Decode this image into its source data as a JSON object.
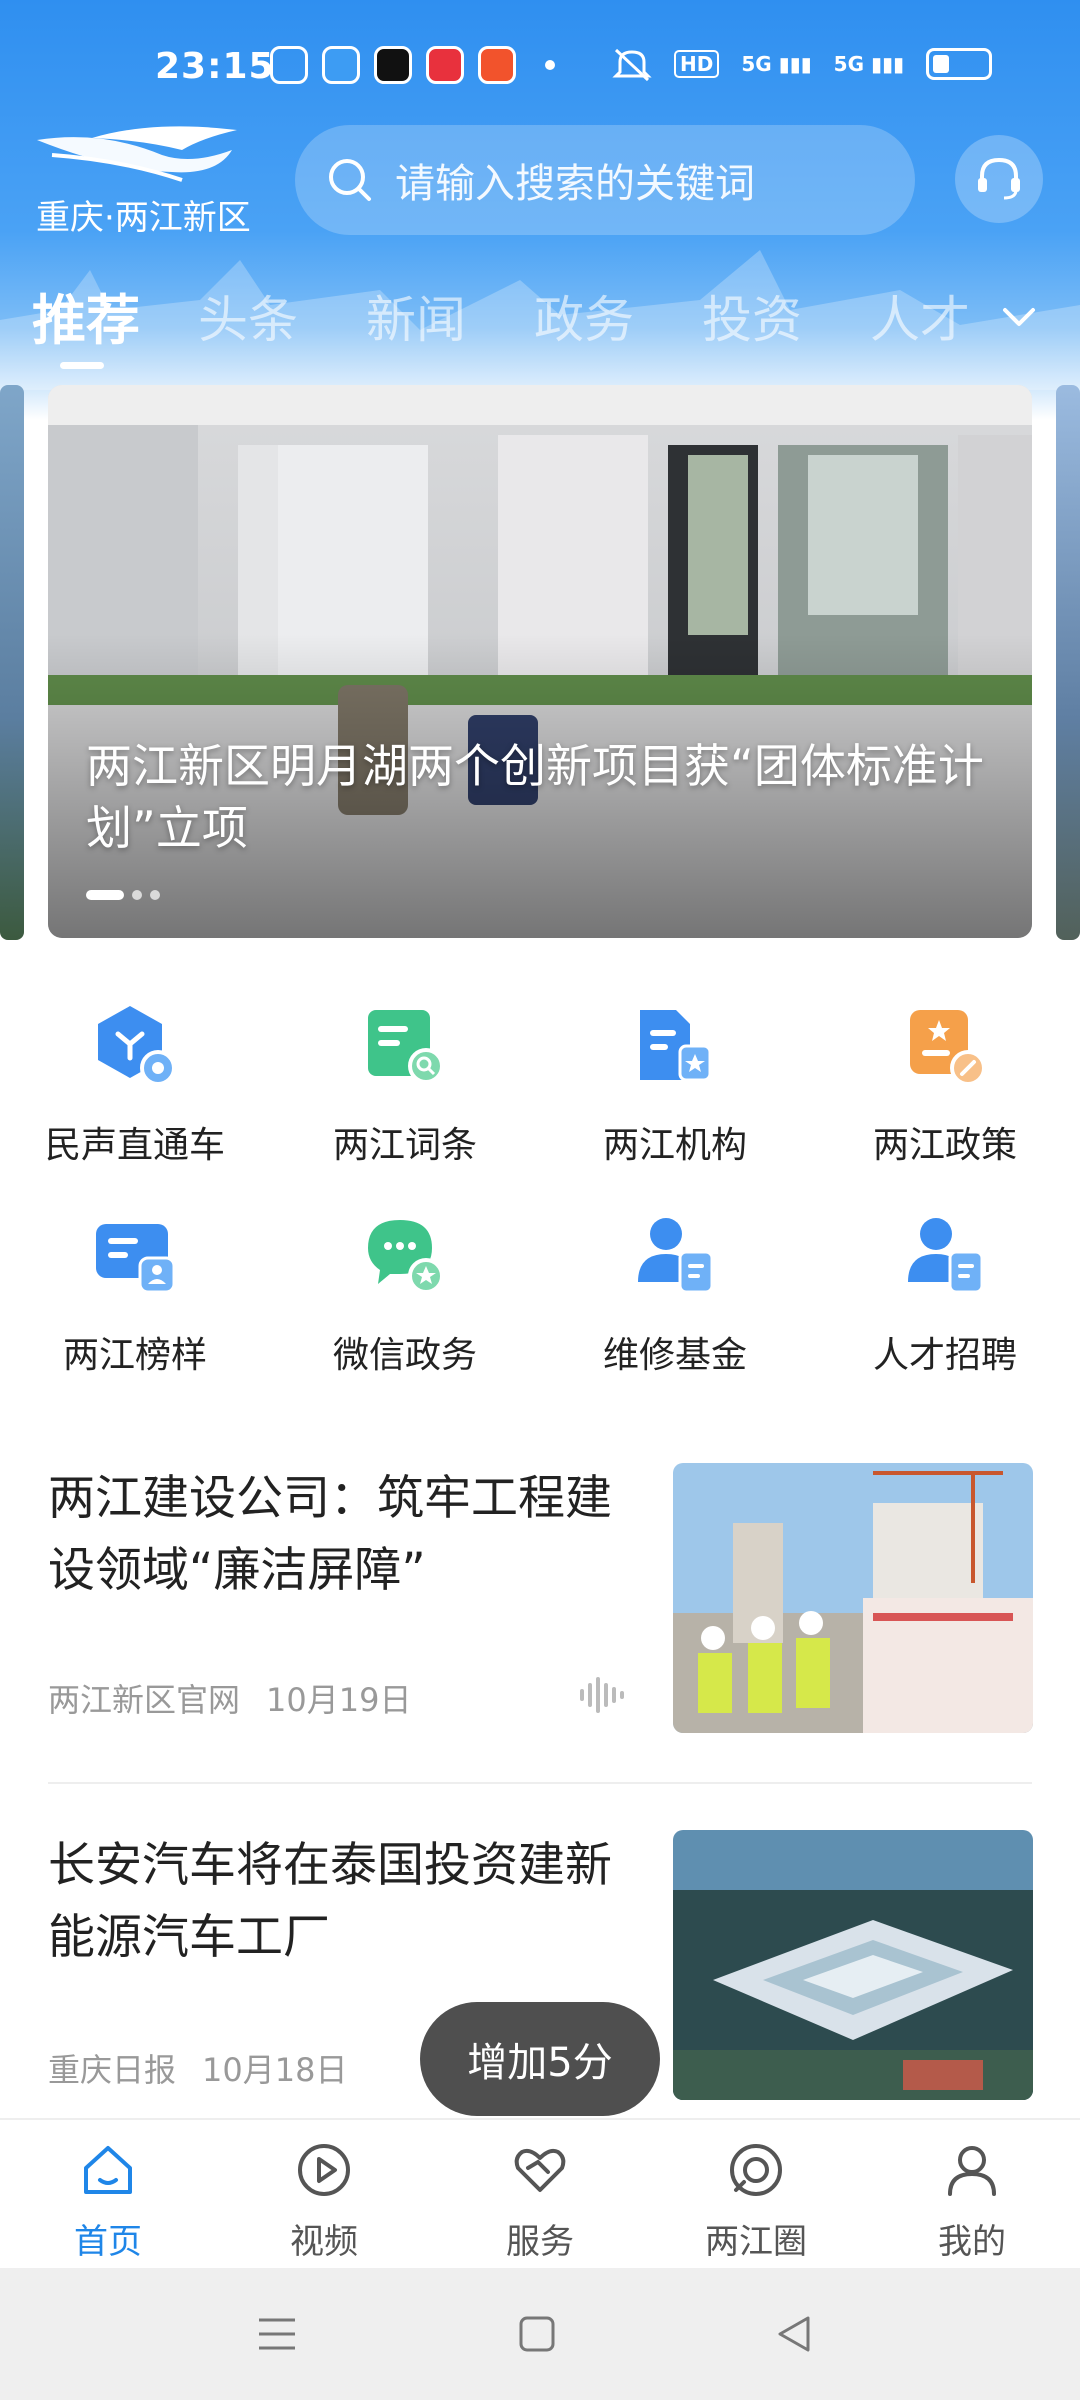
{
  "status_bar": {
    "time": "23:15",
    "hd_label": "HD",
    "sim1": "5G",
    "sim2": "5G"
  },
  "header": {
    "logo_text": "重庆·两江新区",
    "search_placeholder": "请输入搜索的关键词",
    "tabs": [
      {
        "label": "推荐",
        "active": true
      },
      {
        "label": "头条"
      },
      {
        "label": "新闻"
      },
      {
        "label": "政务"
      },
      {
        "label": "投资"
      },
      {
        "label": "人才"
      }
    ]
  },
  "banner": {
    "title": "两江新区明月湖两个创新项目获“团体标准计划”立项",
    "page_count": 3,
    "active_page": 1
  },
  "quick_services": [
    {
      "label": "民声直通车",
      "icon": "hexagon-chat-icon",
      "color": "#3d8ef0"
    },
    {
      "label": "两江词条",
      "icon": "document-search-icon",
      "color": "#3fc48a"
    },
    {
      "label": "两江机构",
      "icon": "building-star-icon",
      "color": "#3d8ef0"
    },
    {
      "label": "两江政策",
      "icon": "policy-edit-icon",
      "color": "#f5a04a"
    },
    {
      "label": "两江榜样",
      "icon": "card-person-icon",
      "color": "#3d8ef0"
    },
    {
      "label": "微信政务",
      "icon": "wechat-star-icon",
      "color": "#3fc48a"
    },
    {
      "label": "维修基金",
      "icon": "person-document-icon",
      "color": "#3d8ef0"
    },
    {
      "label": "人才招聘",
      "icon": "person-document-icon",
      "color": "#3d8ef0"
    }
  ],
  "news": [
    {
      "title": "两江建设公司：筑牢工程建设领域“廉洁屏障”",
      "source": "两江新区官网",
      "date": "10月19日",
      "has_audio": true
    },
    {
      "title": "长安汽车将在泰国投资建新能源汽车工厂",
      "source": "重庆日报",
      "date": "10月18日",
      "has_audio": false
    }
  ],
  "toast": "增加5分",
  "bottom_nav": [
    {
      "label": "首页",
      "icon": "home-icon",
      "active": true
    },
    {
      "label": "视频",
      "icon": "play-circle-icon"
    },
    {
      "label": "服务",
      "icon": "handshake-icon"
    },
    {
      "label": "两江圈",
      "icon": "circle-chat-icon"
    },
    {
      "label": "我的",
      "icon": "user-icon"
    }
  ],
  "colors": {
    "accent": "#1f86e8",
    "header_blue": "#2f8ff0"
  }
}
